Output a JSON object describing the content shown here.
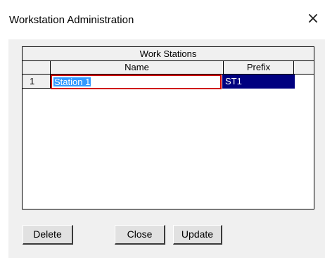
{
  "window": {
    "title": "Workstation Administration",
    "close_glyph": "×"
  },
  "grid": {
    "group_header": "Work Stations",
    "columns": [
      "Name",
      "Prefix"
    ],
    "rows": [
      {
        "number": "1",
        "name": "Station 1",
        "prefix": "ST1"
      }
    ]
  },
  "buttons": {
    "delete_label": "Delete",
    "close_label": "Close",
    "update_label": "Update"
  },
  "colors": {
    "selection": "#3399ff",
    "focus_border": "#d00000",
    "selected_cell": "#000080"
  }
}
